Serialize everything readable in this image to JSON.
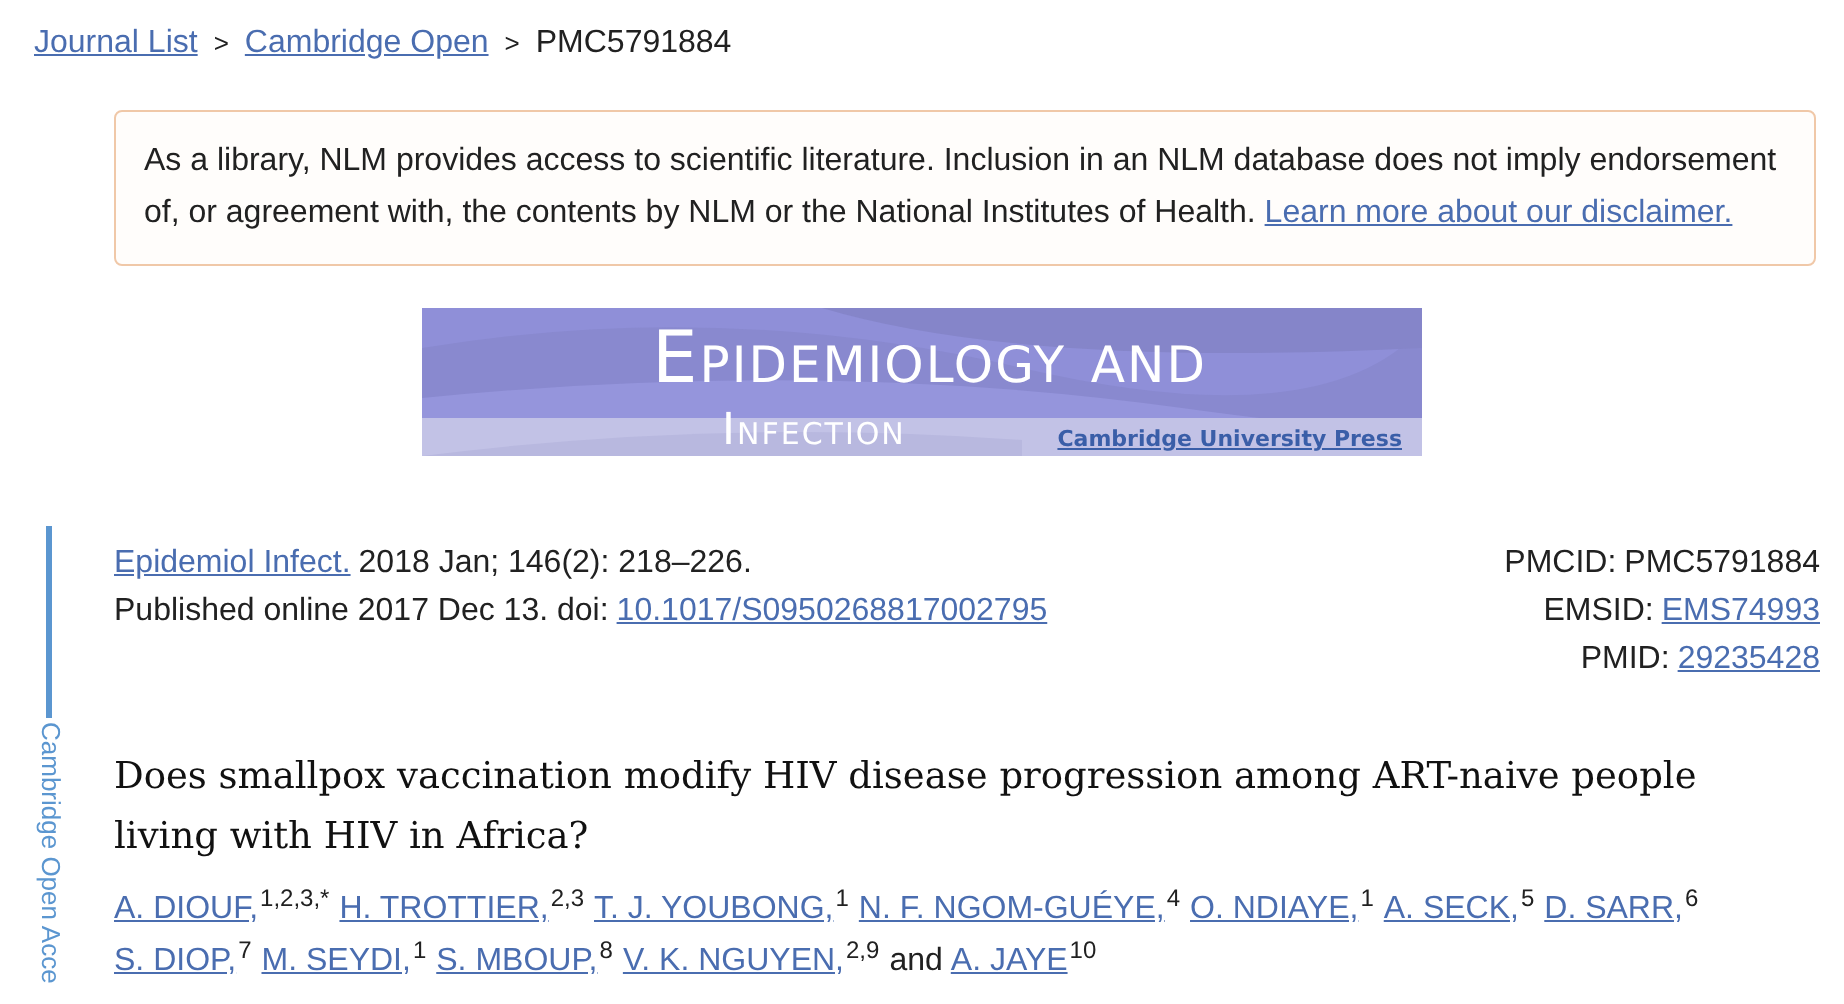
{
  "breadcrumb": [
    {
      "label": "Journal List",
      "link": true
    },
    {
      "label": "Cambridge Open",
      "link": true
    },
    {
      "label": "PMC5791884",
      "link": false
    }
  ],
  "breadcrumb_separator": ">",
  "disclaimer": {
    "text": "As a library, NLM provides access to scientific literature. Inclusion in an NLM database does not imply endorsement of, or agreement with, the contents by NLM or the National Institutes of Health.",
    "link": "Learn more about our disclaimer."
  },
  "banner": {
    "title_line_1": "Epidemiology and",
    "title_line_2": "Infection",
    "publisher": "Cambridge University Press"
  },
  "side_tab": "Cambridge Open Acce",
  "citation": {
    "journal": "Epidemiol Infect.",
    "details": "2018 Jan; 146(2): 218–226.",
    "published": "Published online 2017 Dec 13. doi:",
    "doi": "10.1017/S0950268817002795"
  },
  "identifiers": [
    {
      "label": "PMCID:",
      "value": "PMC5791884",
      "link": false
    },
    {
      "label": "EMSID:",
      "value": "EMS74993",
      "link": true
    },
    {
      "label": "PMID:",
      "value": "29235428",
      "link": true
    }
  ],
  "title": "Does smallpox vaccination modify HIV disease progression among ART-naive people living with HIV in Africa?",
  "authors": [
    {
      "name": "A. DIOUF,",
      "affiliations": "1,2,3,*"
    },
    {
      "name": "H. TROTTIER,",
      "affiliations": "2,3"
    },
    {
      "name": "T. J. YOUBONG,",
      "affiliations": "1"
    },
    {
      "name": "N. F. NGOM-GUÉYE,",
      "affiliations": "4"
    },
    {
      "name": "O. NDIAYE,",
      "affiliations": "1"
    },
    {
      "name": "A. SECK,",
      "affiliations": "5"
    },
    {
      "name": "D. SARR,",
      "affiliations": "6"
    },
    {
      "name": "S. DIOP,",
      "affiliations": "7"
    },
    {
      "name": "M. SEYDI,",
      "affiliations": "1"
    },
    {
      "name": "S. MBOUP,",
      "affiliations": "8"
    },
    {
      "name": "V. K. NGUYEN,",
      "affiliations": "2,9"
    },
    {
      "name": "A. JAYE",
      "affiliations": "10",
      "conjunction": "and"
    }
  ]
}
